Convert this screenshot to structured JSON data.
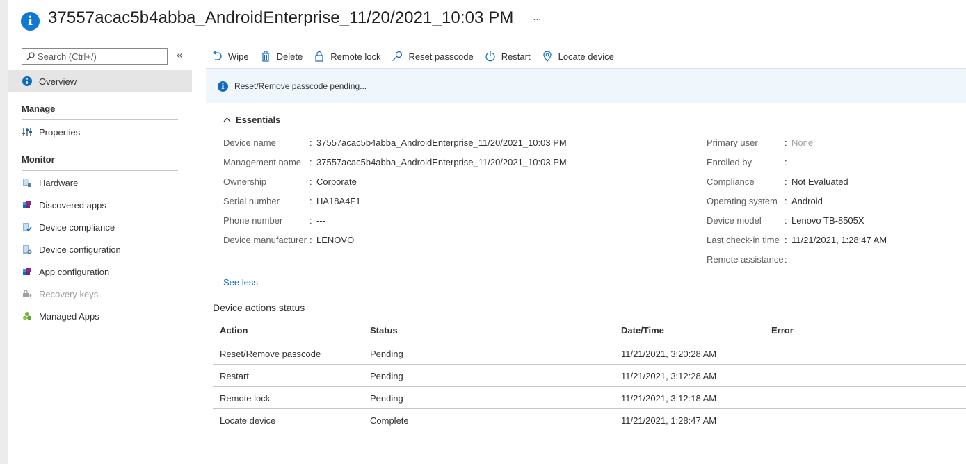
{
  "header": {
    "title": "37557acac5b4abba_AndroidEnterprise_11/20/2021_10:03 PM",
    "more": "...",
    "icon": "info-icon"
  },
  "sidebar": {
    "search_placeholder": "Search (Ctrl+/)",
    "collapse": "«",
    "overview": "Overview",
    "manage_heading": "Manage",
    "properties": "Properties",
    "monitor_heading": "Monitor",
    "monitor_items": [
      "Hardware",
      "Discovered apps",
      "Device compliance",
      "Device configuration",
      "App configuration",
      "Recovery keys",
      "Managed Apps"
    ]
  },
  "toolbar": {
    "wipe": "Wipe",
    "delete": "Delete",
    "remote_lock": "Remote lock",
    "reset_passcode": "Reset passcode",
    "restart": "Restart",
    "locate_device": "Locate device"
  },
  "banner": {
    "message": "Reset/Remove passcode pending..."
  },
  "essentials": {
    "heading": "Essentials",
    "left": [
      {
        "label": "Device name",
        "value": "37557acac5b4abba_AndroidEnterprise_11/20/2021_10:03 PM"
      },
      {
        "label": "Management name",
        "value": "37557acac5b4abba_AndroidEnterprise_11/20/2021_10:03 PM"
      },
      {
        "label": "Ownership",
        "value": "Corporate"
      },
      {
        "label": "Serial number",
        "value": "HA18A4F1"
      },
      {
        "label": "Phone number",
        "value": "---"
      },
      {
        "label": "Device manufacturer",
        "value": "LENOVO"
      }
    ],
    "right": [
      {
        "label": "Primary user",
        "value": "None"
      },
      {
        "label": "Enrolled by",
        "value": ""
      },
      {
        "label": "Compliance",
        "value": "Not Evaluated"
      },
      {
        "label": "Operating system",
        "value": "Android"
      },
      {
        "label": "Device model",
        "value": "Lenovo TB-8505X"
      },
      {
        "label": "Last check-in time",
        "value": "11/21/2021, 1:28:47 AM"
      },
      {
        "label": "Remote assistance",
        "value": ""
      }
    ],
    "colon": ":",
    "see_less": "See less"
  },
  "actions_table": {
    "title": "Device actions status",
    "columns": [
      "Action",
      "Status",
      "Date/Time",
      "Error"
    ],
    "rows": [
      [
        "Reset/Remove passcode",
        "Pending",
        "11/21/2021, 3:20:28 AM",
        ""
      ],
      [
        "Restart",
        "Pending",
        "11/21/2021, 3:12:28 AM",
        ""
      ],
      [
        "Remote lock",
        "Pending",
        "11/21/2021, 3:12:18 AM",
        ""
      ],
      [
        "Locate device",
        "Complete",
        "11/21/2021, 1:28:47 AM",
        ""
      ]
    ]
  },
  "colors": {
    "accent": "#0f6cbd",
    "banner_bg": "#eff6fc",
    "selected_nav": "#e5e5e5"
  }
}
